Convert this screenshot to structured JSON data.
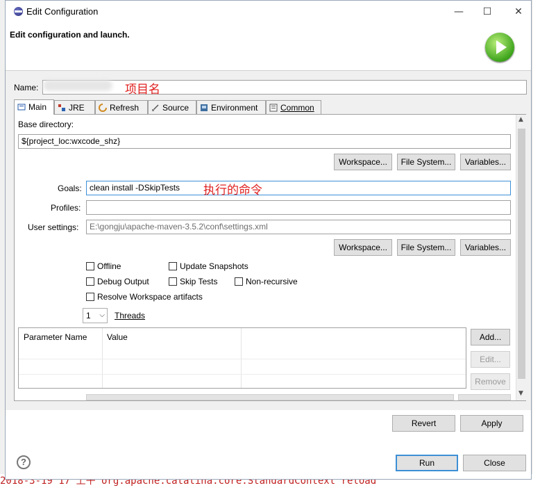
{
  "window": {
    "title": "Edit Configuration",
    "header_title": "Edit configuration and launch.",
    "buttons": {
      "minimize": "—",
      "maximize": "☐",
      "close": "✕"
    }
  },
  "name": {
    "label": "Name:",
    "value": ""
  },
  "annotations": {
    "project_name": "项目名",
    "goals_note": "执行的命令"
  },
  "tabs": [
    {
      "label": "Main",
      "icon": "main-icon"
    },
    {
      "label": "JRE",
      "icon": "jre-icon"
    },
    {
      "label": "Refresh",
      "icon": "refresh-icon"
    },
    {
      "label": "Source",
      "icon": "source-icon"
    },
    {
      "label": "Environment",
      "icon": "environment-icon"
    },
    {
      "label": "Common",
      "icon": "common-icon"
    }
  ],
  "main": {
    "base_dir_label": "Base directory:",
    "base_dir_value": "${project_loc:wxcode_shz}",
    "goals_label": "Goals:",
    "goals_value": "clean install -DSkipTests",
    "profiles_label": "Profiles:",
    "profiles_value": "",
    "user_settings_label": "User settings:",
    "user_settings_value": "E:\\gongju\\apache-maven-3.5.2\\conf\\settings.xml",
    "workspace_btn": "Workspace...",
    "filesystem_btn": "File System...",
    "variables_btn": "Variables...",
    "checkboxes": {
      "offline": "Offline",
      "update_snapshots": "Update Snapshots",
      "debug_output": "Debug Output",
      "skip_tests": "Skip Tests",
      "non_recursive": "Non-recursive",
      "resolve_workspace": "Resolve Workspace artifacts"
    },
    "threads_value": "1",
    "threads_label": "Threads",
    "table_headers": [
      "Parameter Name",
      "Value"
    ],
    "add_btn": "Add...",
    "edit_btn": "Edit...",
    "remove_btn": "Remove"
  },
  "footer": {
    "revert": "Revert",
    "apply": "Apply",
    "run": "Run",
    "close": "Close",
    "help": "?"
  },
  "background_code": "2018-3-19 17 上午 org.apache.catalina.core.StandardContext reload"
}
